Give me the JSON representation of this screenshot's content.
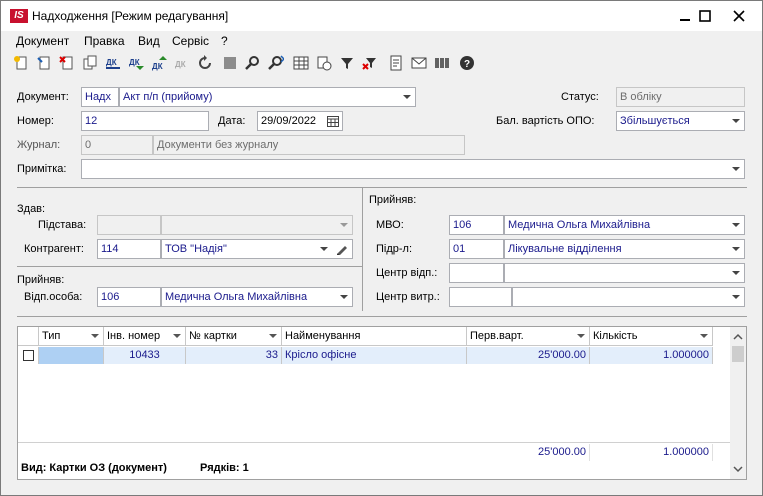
{
  "window": {
    "title": "Надходження [Режим редагування]",
    "logo": "IS"
  },
  "menu": [
    "Документ",
    "Правка",
    "Вид",
    "Сервіс",
    "?"
  ],
  "toolbar_icons": [
    "new-doc-icon",
    "copy-doc-icon",
    "delete-doc-icon",
    "copy-icon",
    "dk-icon",
    "dk-down-icon",
    "dk-up-icon",
    "dk-disabled-icon",
    "refresh-icon",
    "stop-icon",
    "search-icon",
    "find-next-icon",
    "table-icon",
    "calc-icon",
    "filter-icon",
    "clear-filter-icon",
    "doc-icon",
    "mail-icon",
    "barcode-icon",
    "help-icon"
  ],
  "header": {
    "document_label": "Документ:",
    "document_code": "Надх",
    "document_type": "Акт п/п (прийому)",
    "status_label": "Статус:",
    "status_value": "В обліку",
    "number_label": "Номер:",
    "number_value": "12",
    "date_label": "Дата:",
    "date_value": "29/09/2022",
    "balance_label": "Бал. вартість ОПО:",
    "balance_value": "Збільшується",
    "journal_label": "Журнал:",
    "journal_code": "0",
    "journal_value": "Документи без журналу",
    "note_label": "Примітка:",
    "note_value": ""
  },
  "left": {
    "gave_label": "Здав:",
    "basis_label": "Підстава:",
    "basis_code": "",
    "basis_value": "",
    "contractor_label": "Контрагент:",
    "contractor_code": "114",
    "contractor_value": "ТОВ \"Надія\"",
    "received_label": "Прийняв:",
    "resp_label": "Відп.особа:",
    "resp_code": "106",
    "resp_value": "Медична Ольга Михайлівна"
  },
  "right": {
    "received_label": "Прийняв:",
    "mvo_label": "МВО:",
    "mvo_code": "106",
    "mvo_value": "Медична Ольга Михайлівна",
    "dept_label": "Підр-л:",
    "dept_code": "01",
    "dept_value": "Лікувальне відділення",
    "center_resp_label": "Центр відп.:",
    "center_resp_code": "",
    "center_resp_value": "",
    "center_cost_label": "Центр витр.:",
    "center_cost_code": "",
    "center_cost_value": ""
  },
  "grid": {
    "columns": [
      "Тип",
      "Інв. номер",
      "№ картки",
      "Найменування",
      "Перв.варт.",
      "Кількість"
    ],
    "rows": [
      {
        "type": "",
        "inv": "10433",
        "card": "33",
        "name": "Крісло офісне",
        "cost": "25'000.00",
        "qty": "1.000000"
      }
    ],
    "totals": {
      "cost": "25'000.00",
      "qty": "1.000000"
    },
    "view_label": "Вид: Картки ОЗ (документ)",
    "rows_label": "Рядків: 1"
  }
}
